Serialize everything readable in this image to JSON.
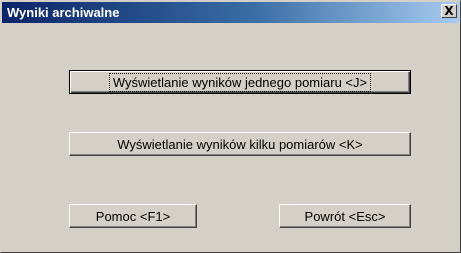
{
  "window": {
    "title": "Wyniki archiwalne",
    "close_label": "X"
  },
  "buttons": {
    "single_measurement": "Wyświetlanie wyników jednego pomiaru  <J>",
    "multiple_measurements": "Wyświetlanie wyników kilku pomiarów  <K>",
    "help": "Pomoc  <F1>",
    "back": "Powrót  <Esc>"
  }
}
